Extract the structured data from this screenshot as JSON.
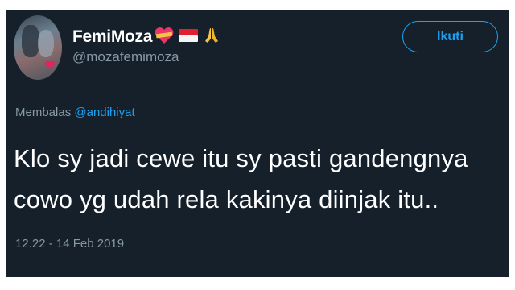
{
  "user": {
    "display_name": "FemiMoza",
    "handle": "@mozafemimoza",
    "name_emojis": [
      "heart-ribbon-icon",
      "indonesia-flag-icon",
      "praying-hands-icon"
    ]
  },
  "follow_button": {
    "label": "Ikuti"
  },
  "reply": {
    "prefix": "Membalas",
    "mention": "@andihiyat"
  },
  "tweet": {
    "line1": "Klo sy jadi cewe itu sy pasti gandengnya",
    "line2": "cowo yg udah rela kakinya diinjak itu.."
  },
  "timestamp": "12.22 - 14 Feb 2019",
  "colors": {
    "background": "#15202b",
    "accent": "#1da1f2",
    "secondary_text": "#8899a6",
    "primary_text": "#ffffff"
  }
}
